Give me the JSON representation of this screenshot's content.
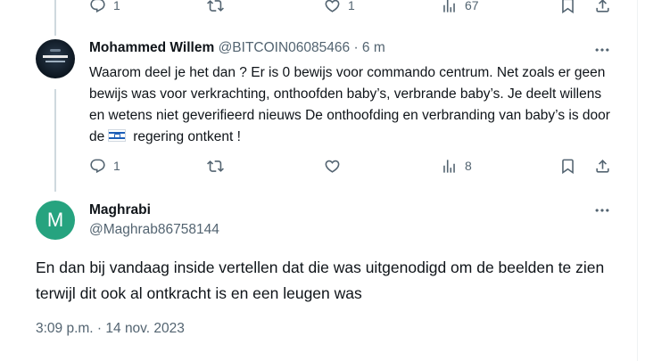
{
  "top_actions": {
    "reply_count": "1",
    "like_count": "1",
    "views_count": "67"
  },
  "reply_tweet": {
    "author_name": "Mohammed Willem",
    "author_handle": "@BITCOIN06085466",
    "separator": "·",
    "time_ago": "6 m",
    "text_before_flag": "Waarom deel je het dan ? Er is 0 bewijs voor commando centrum. Net zoals er geen bewijs was voor verkrachting, onthoofden baby’s, verbrande baby’s. Je deelt willens en wetens niet  geverifieerd nieuws De onthoofding en verbranding van baby’s is door de",
    "text_after_flag": "regering ontkent !",
    "reply_count": "1",
    "views_count": "8"
  },
  "main_tweet": {
    "avatar_letter": "M",
    "author_name": "Maghrabi",
    "author_handle": "@Maghrab86758144",
    "text": "En dan bij vandaag inside vertellen dat die was uitgenodigd om de beelden te zien terwijl dit ook al ontkracht is en een leugen was",
    "timestamp": "3:09 p.m. · 14 nov. 2023"
  },
  "icons": {
    "reply": "reply-icon",
    "retweet": "retweet-icon",
    "like": "heart-icon",
    "views": "views-chart-icon",
    "bookmark": "bookmark-icon",
    "share": "share-icon",
    "more": "more-options-icon",
    "flag": "israel-flag-emoji"
  },
  "colors": {
    "text": "#0f1419",
    "secondary": "#536471",
    "thread_line": "#cfd9de",
    "avatar_green": "#26a37f"
  }
}
